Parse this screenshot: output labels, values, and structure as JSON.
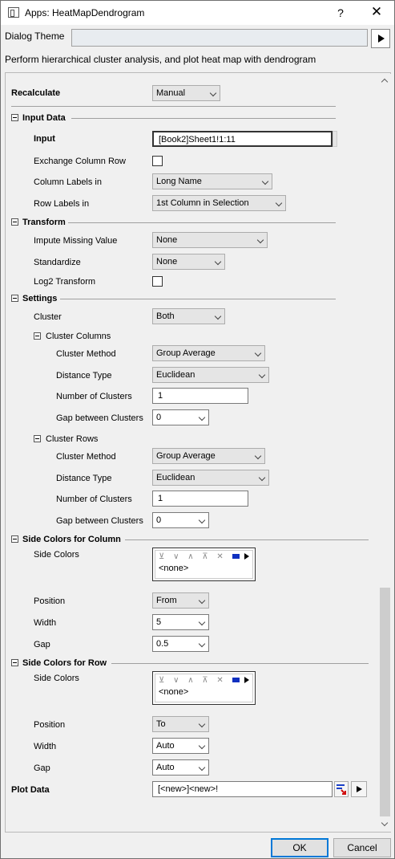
{
  "window": {
    "title": "Apps: HeatMapDendrogram",
    "help_glyph": "?",
    "close_glyph": "✕"
  },
  "theme": {
    "label": "Dialog Theme",
    "value": ""
  },
  "description": "Perform hierarchical cluster analysis, and plot heat map with dendrogram",
  "recalculate": {
    "label": "Recalculate",
    "value": "Manual"
  },
  "input_data": {
    "header": "Input Data",
    "input_label": "Input",
    "input_value": "[Book2]Sheet1!1:11",
    "exchange_label": "Exchange Column Row",
    "exchange_checked": false,
    "col_labels_label": "Column Labels in",
    "col_labels_value": "Long Name",
    "row_labels_label": "Row Labels in",
    "row_labels_value": "1st Column in Selection"
  },
  "transform": {
    "header": "Transform",
    "impute_label": "Impute Missing Value",
    "impute_value": "None",
    "standardize_label": "Standardize",
    "standardize_value": "None",
    "log2_label": "Log2 Transform",
    "log2_checked": false
  },
  "settings": {
    "header": "Settings",
    "cluster_label": "Cluster",
    "cluster_value": "Both",
    "cluster_columns": {
      "header": "Cluster Columns",
      "method_label": "Cluster Method",
      "method_value": "Group Average",
      "distance_label": "Distance Type",
      "distance_value": "Euclidean",
      "num_label": "Number of Clusters",
      "num_value": "1",
      "gap_label": "Gap between Clusters",
      "gap_value": "0"
    },
    "cluster_rows": {
      "header": "Cluster Rows",
      "method_label": "Cluster Method",
      "method_value": "Group Average",
      "distance_label": "Distance Type",
      "distance_value": "Euclidean",
      "num_label": "Number of Clusters",
      "num_value": "1",
      "gap_label": "Gap between Clusters",
      "gap_value": "0"
    }
  },
  "side_colors_column": {
    "header": "Side Colors for Column",
    "side_colors_label": "Side Colors",
    "side_colors_value": "<none>",
    "position_label": "Position",
    "position_value": "From",
    "width_label": "Width",
    "width_value": "5",
    "gap_label": "Gap",
    "gap_value": "0.5"
  },
  "side_colors_row": {
    "header": "Side Colors for Row",
    "side_colors_label": "Side Colors",
    "side_colors_value": "<none>",
    "position_label": "Position",
    "position_value": "To",
    "width_label": "Width",
    "width_value": "Auto",
    "gap_label": "Gap",
    "gap_value": "Auto"
  },
  "plot_data": {
    "label": "Plot Data",
    "value": "[<new>]<new>!"
  },
  "buttons": {
    "ok": "OK",
    "cancel": "Cancel"
  },
  "colors": {
    "accent": "#0078d7",
    "swatch": "#1030c0"
  }
}
